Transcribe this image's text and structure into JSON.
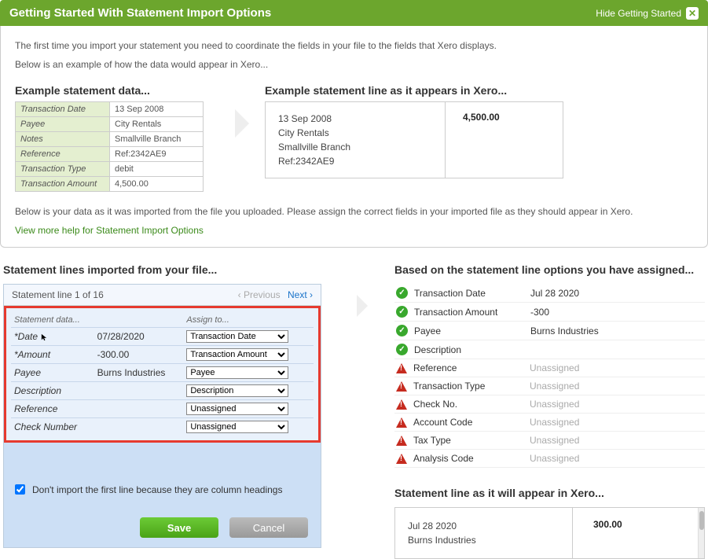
{
  "banner": {
    "title": "Getting Started With Statement Import Options",
    "hide_label": "Hide Getting Started"
  },
  "intro": {
    "p1": "The first time you import your statement you need to coordinate the fields in your file to the fields that Xero displays.",
    "p2": "Below is an example of how the data would appear in Xero..."
  },
  "example": {
    "left_title": "Example statement data...",
    "right_title": "Example statement line as it appears in Xero...",
    "rows": [
      {
        "label": "Transaction Date",
        "value": "13 Sep 2008"
      },
      {
        "label": "Payee",
        "value": "City Rentals"
      },
      {
        "label": "Notes",
        "value": "Smallville Branch"
      },
      {
        "label": "Reference",
        "value": "Ref:2342AE9"
      },
      {
        "label": "Transaction Type",
        "value": "debit"
      },
      {
        "label": "Transaction Amount",
        "value": "4,500.00"
      }
    ],
    "xero_box": {
      "date": "13 Sep 2008",
      "payee": "City Rentals",
      "notes": "Smallville Branch",
      "ref": "Ref:2342AE9",
      "amount": "4,500.00"
    }
  },
  "intro2": "Below is your data as it was imported from the file you uploaded. Please assign the correct fields in your imported file as they should appear in Xero.",
  "help_link": "View more help for Statement Import Options",
  "left_section": {
    "title": "Statement lines imported from your file...",
    "line_info": "Statement line 1 of 16",
    "prev": "‹ Previous",
    "next": "Next ›",
    "col1": "Statement data...",
    "col2": "Assign to...",
    "rows": [
      {
        "label": "*Date",
        "value": "07/28/2020",
        "select": "Transaction Date"
      },
      {
        "label": "*Amount",
        "value": "-300.00",
        "select": "Transaction Amount"
      },
      {
        "label": "Payee",
        "value": "Burns Industries",
        "select": "Payee"
      },
      {
        "label": "Description",
        "value": "",
        "select": "Description"
      },
      {
        "label": "Reference",
        "value": "",
        "select": "Unassigned"
      },
      {
        "label": "Check Number",
        "value": "",
        "select": "Unassigned"
      }
    ],
    "checkbox_label": "Don't import the first line because they are column headings",
    "save": "Save",
    "cancel": "Cancel"
  },
  "right_section": {
    "title": "Based on the statement line options you have assigned...",
    "rows": [
      {
        "ok": true,
        "label": "Transaction Date",
        "value": "Jul 28 2020"
      },
      {
        "ok": true,
        "label": "Transaction Amount",
        "value": "-300"
      },
      {
        "ok": true,
        "label": "Payee",
        "value": "Burns Industries"
      },
      {
        "ok": true,
        "label": "Description",
        "value": ""
      },
      {
        "ok": false,
        "label": "Reference",
        "value": "Unassigned"
      },
      {
        "ok": false,
        "label": "Transaction Type",
        "value": "Unassigned"
      },
      {
        "ok": false,
        "label": "Check No.",
        "value": "Unassigned"
      },
      {
        "ok": false,
        "label": "Account Code",
        "value": "Unassigned"
      },
      {
        "ok": false,
        "label": "Tax Type",
        "value": "Unassigned"
      },
      {
        "ok": false,
        "label": "Analysis Code",
        "value": "Unassigned"
      }
    ],
    "appear_title": "Statement line as it will appear in Xero...",
    "appear": {
      "date": "Jul 28 2020",
      "payee": "Burns Industries",
      "amount": "300.00"
    }
  }
}
